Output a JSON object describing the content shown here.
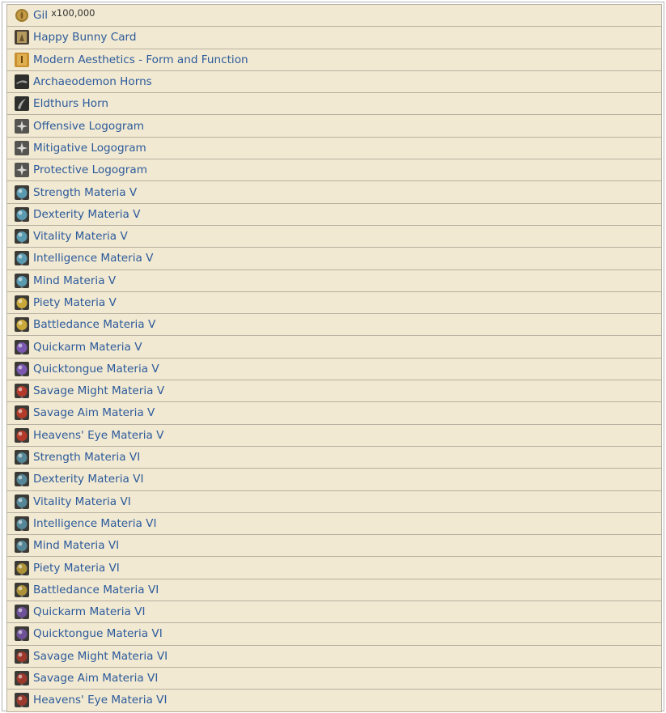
{
  "colors": {
    "row_background": "#f1e9d1",
    "row_border": "#b8b0a0",
    "link_text": "#2c5a9c",
    "materia_green": "#5a9ab0",
    "materia_yellow": "#c9a83a",
    "materia_purple": "#7a58b0",
    "materia_red": "#b33a2a"
  },
  "items": [
    {
      "name": "Gil",
      "quantity": "x100,000",
      "icon": "gil-coin-icon"
    },
    {
      "name": "Happy Bunny Card",
      "icon": "bunny-card-icon"
    },
    {
      "name": "Modern Aesthetics - Form and Function",
      "icon": "aesthetics-book-icon"
    },
    {
      "name": "Archaeodemon Horns",
      "icon": "horns-icon"
    },
    {
      "name": "Eldthurs Horn",
      "icon": "horn-icon"
    },
    {
      "name": "Offensive Logogram",
      "icon": "logogram-icon"
    },
    {
      "name": "Mitigative Logogram",
      "icon": "logogram-icon"
    },
    {
      "name": "Protective Logogram",
      "icon": "logogram-icon"
    },
    {
      "name": "Strength Materia V",
      "icon": "materia-green-icon"
    },
    {
      "name": "Dexterity Materia V",
      "icon": "materia-green-icon"
    },
    {
      "name": "Vitality Materia V",
      "icon": "materia-green-icon"
    },
    {
      "name": "Intelligence Materia V",
      "icon": "materia-green-icon"
    },
    {
      "name": "Mind Materia V",
      "icon": "materia-green-icon"
    },
    {
      "name": "Piety Materia V",
      "icon": "materia-yellow-icon"
    },
    {
      "name": "Battledance Materia V",
      "icon": "materia-yellow-icon"
    },
    {
      "name": "Quickarm Materia V",
      "icon": "materia-purple-icon"
    },
    {
      "name": "Quicktongue Materia V",
      "icon": "materia-purple-icon"
    },
    {
      "name": "Savage Might Materia V",
      "icon": "materia-red-icon"
    },
    {
      "name": "Savage Aim Materia V",
      "icon": "materia-red-icon"
    },
    {
      "name": "Heavens' Eye Materia V",
      "icon": "materia-red-icon"
    },
    {
      "name": "Strength Materia VI",
      "icon": "materia-green-icon"
    },
    {
      "name": "Dexterity Materia VI",
      "icon": "materia-green-icon"
    },
    {
      "name": "Vitality Materia VI",
      "icon": "materia-green-icon"
    },
    {
      "name": "Intelligence Materia VI",
      "icon": "materia-green-icon"
    },
    {
      "name": "Mind Materia VI",
      "icon": "materia-green-icon"
    },
    {
      "name": "Piety Materia VI",
      "icon": "materia-yellow-icon"
    },
    {
      "name": "Battledance Materia VI",
      "icon": "materia-yellow-icon"
    },
    {
      "name": "Quickarm Materia VI",
      "icon": "materia-purple-icon"
    },
    {
      "name": "Quicktongue Materia VI",
      "icon": "materia-purple-icon"
    },
    {
      "name": "Savage Might Materia VI",
      "icon": "materia-red-icon"
    },
    {
      "name": "Savage Aim Materia VI",
      "icon": "materia-red-icon"
    },
    {
      "name": "Heavens' Eye Materia VI",
      "icon": "materia-red-icon"
    }
  ]
}
